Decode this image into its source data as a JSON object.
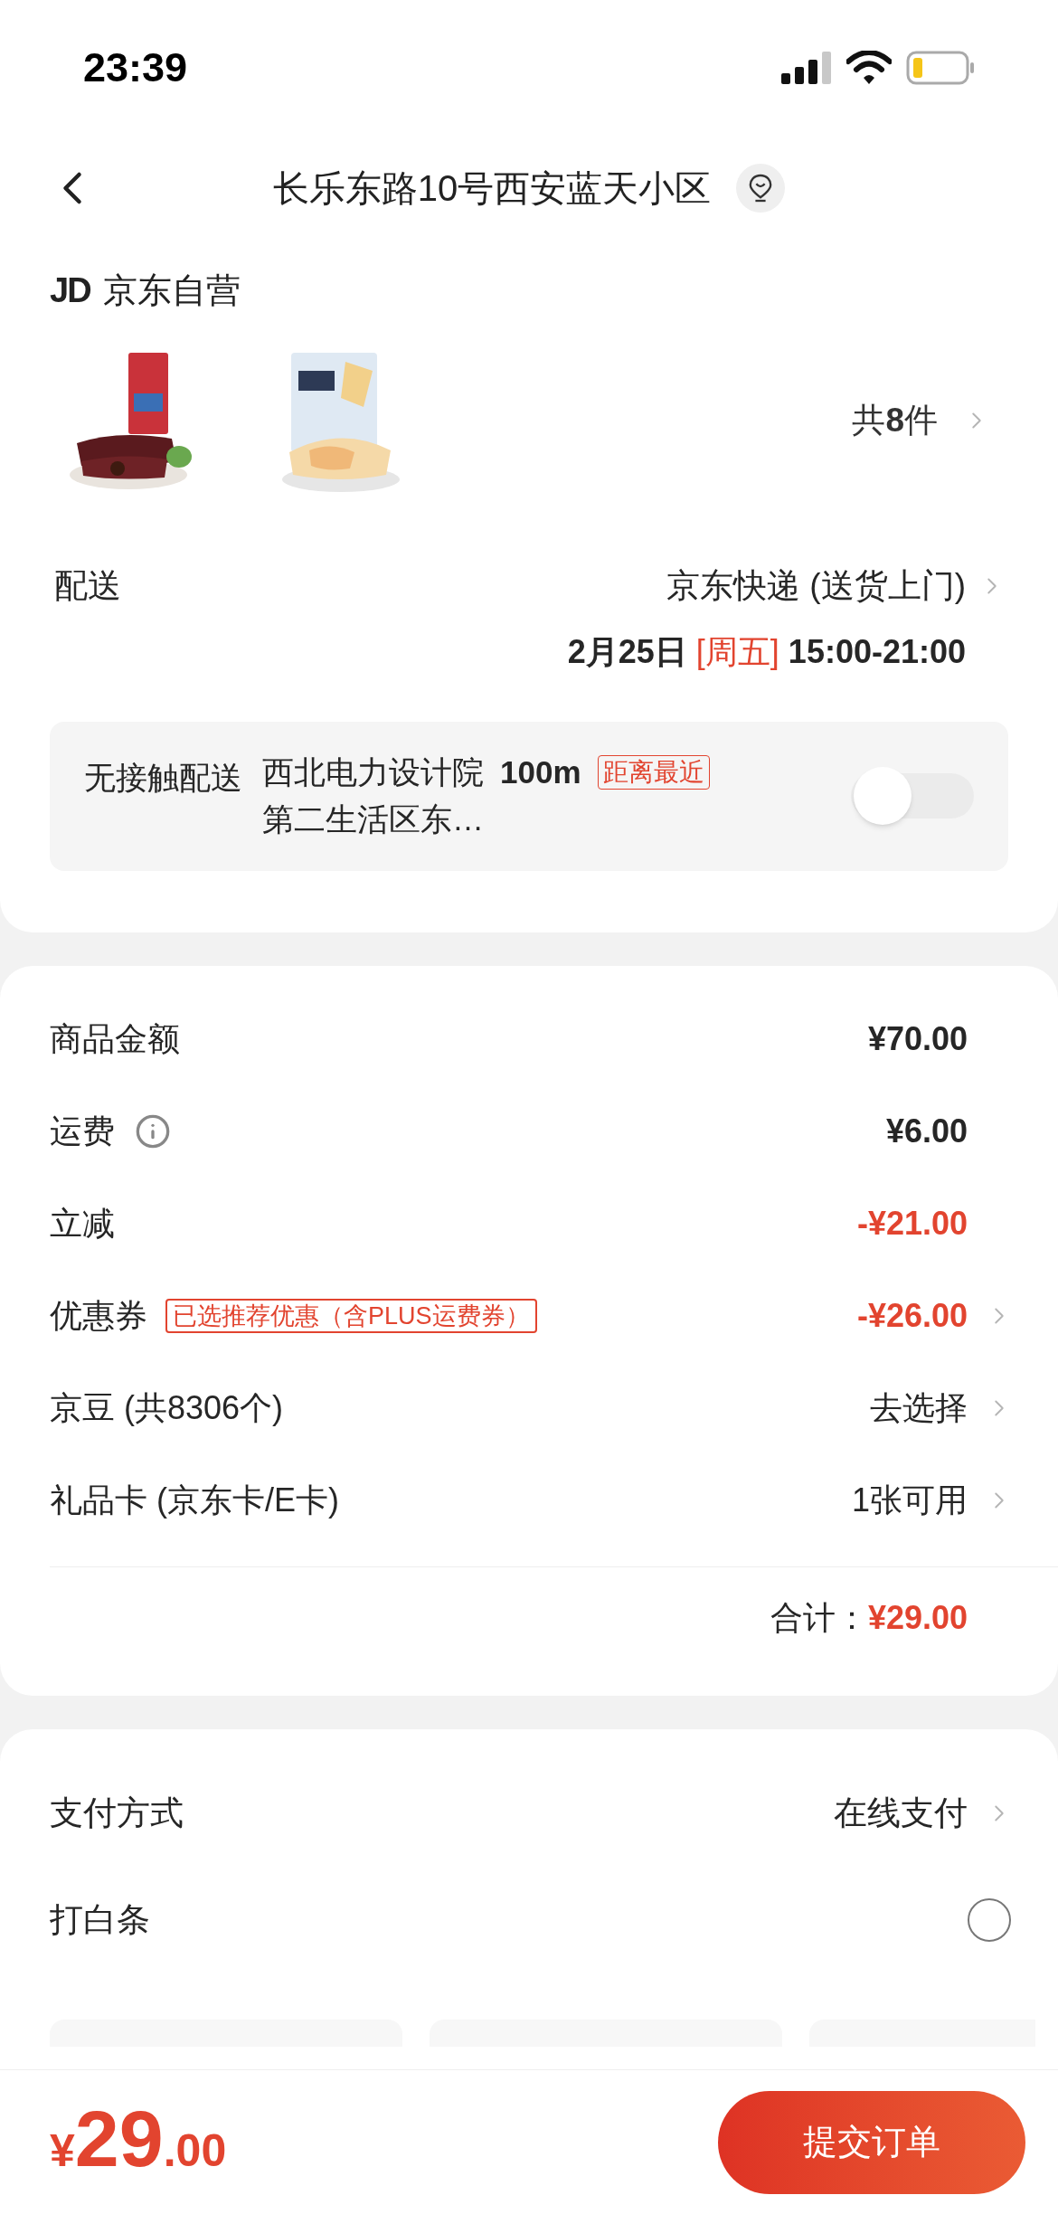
{
  "status_bar": {
    "time": "23:39"
  },
  "header": {
    "title": "长乐东路10号西安蓝天小区"
  },
  "store": {
    "logo": "JD",
    "name": "京东自营"
  },
  "item_count": {
    "prefix": "共",
    "count": "8",
    "suffix": "件"
  },
  "delivery": {
    "label": "配送",
    "method": "京东快递 (送货上门)",
    "date": "2月25日",
    "weekday": "[周五]",
    "time": "15:00-21:00"
  },
  "contactless": {
    "label": "无接触配送",
    "place": "西北电力设计院",
    "distance": "100m",
    "tag": "距离最近",
    "place_line2": "第二生活区东…",
    "on": false
  },
  "price_rows": [
    {
      "label": "商品金额",
      "value": "¥70.00",
      "highlight": false,
      "arrow": false,
      "info": false
    },
    {
      "label": "运费",
      "value": "¥6.00",
      "highlight": false,
      "arrow": false,
      "info": true
    },
    {
      "label": "立减",
      "value": "-¥21.00",
      "highlight": true,
      "arrow": false,
      "info": false
    },
    {
      "label": "优惠券",
      "tag": "已选推荐优惠（含PLUS运费券）",
      "value": "-¥26.00",
      "highlight": true,
      "arrow": true,
      "info": false
    },
    {
      "label": "京豆 (共8306个)",
      "value": "去选择",
      "highlight": false,
      "arrow": true,
      "info": false
    },
    {
      "label": "礼品卡 (京东卡/E卡)",
      "value": "1张可用",
      "highlight": false,
      "arrow": true,
      "info": false
    }
  ],
  "total": {
    "label": "合计：",
    "value": "¥29.00"
  },
  "payment": {
    "label": "支付方式",
    "value": "在线支付"
  },
  "baitiao": {
    "label": "打白条",
    "checked": false
  },
  "bottom_bar": {
    "currency": "¥",
    "amount": "29",
    "cents": ".00",
    "submit": "提交订单"
  }
}
